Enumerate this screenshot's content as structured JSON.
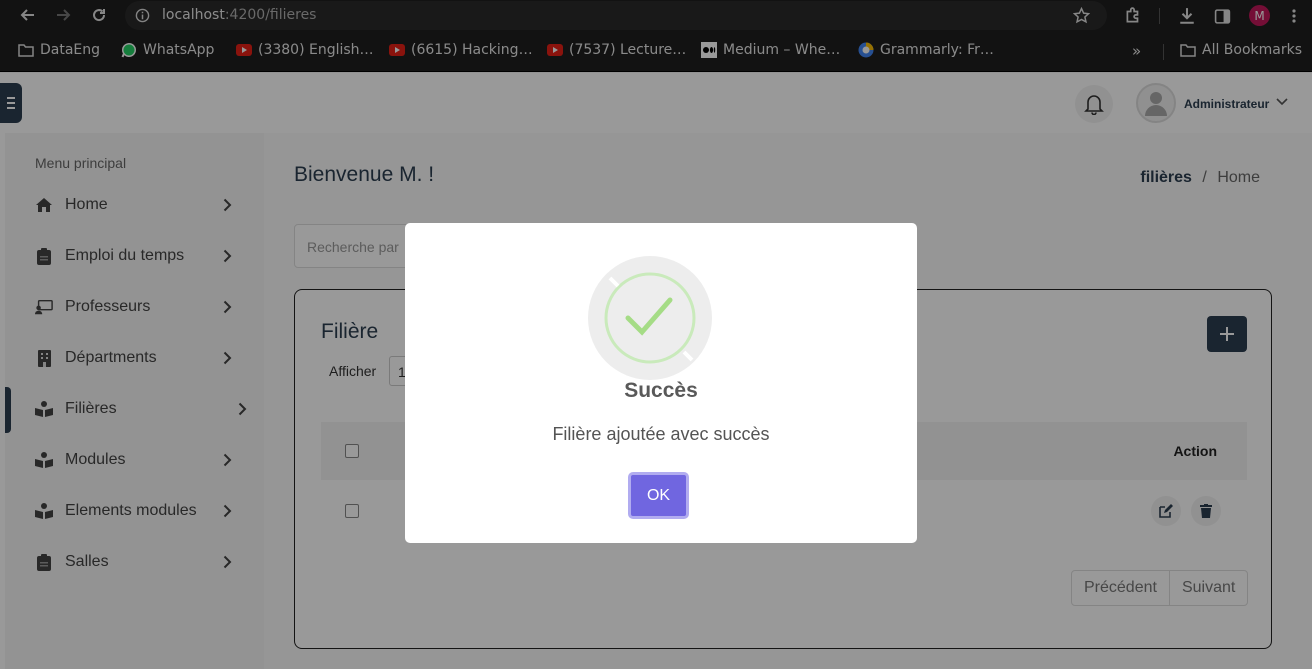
{
  "browser": {
    "url_host": "localhost",
    "url_path": ":4200/filieres",
    "profile_initial": "M",
    "bookmarks": [
      {
        "label": "DataEng",
        "icon": "folder-icon"
      },
      {
        "label": "WhatsApp",
        "icon": "whatsapp-icon"
      },
      {
        "label": "(3380) English…",
        "icon": "youtube-icon"
      },
      {
        "label": "(6615) Hacking…",
        "icon": "youtube-icon"
      },
      {
        "label": "(7537) Lecture…",
        "icon": "youtube-icon"
      },
      {
        "label": "Medium – Whe…",
        "icon": "medium-icon"
      },
      {
        "label": "Grammarly: Fr…",
        "icon": "grammarly-icon"
      }
    ],
    "overflow": "»",
    "all_bookmarks": "All Bookmarks"
  },
  "header": {
    "user_name": "Administrateur"
  },
  "sidebar": {
    "title": "Menu principal",
    "items": [
      {
        "label": "Home",
        "icon": "home-icon"
      },
      {
        "label": "Emploi du temps",
        "icon": "clipboard-icon"
      },
      {
        "label": "Professeurs",
        "icon": "teacher-icon"
      },
      {
        "label": "Départments",
        "icon": "building-icon"
      },
      {
        "label": "Filières",
        "icon": "book-reader-icon",
        "active": true
      },
      {
        "label": "Modules",
        "icon": "book-reader-icon"
      },
      {
        "label": "Elements modules",
        "icon": "book-reader-icon"
      },
      {
        "label": "Salles",
        "icon": "clipboard-icon"
      }
    ]
  },
  "main": {
    "welcome": "Bienvenue M. !",
    "breadcrumb_current": "filières",
    "breadcrumb_sep": "/",
    "breadcrumb_home": "Home",
    "search_placeholder": "Recherche par",
    "card_title": "Filière",
    "show_label": "Afficher",
    "show_value": "1",
    "action_header": "Action",
    "prev": "Précédent",
    "next": "Suivant"
  },
  "modal": {
    "title": "Succès",
    "message": "Filière ajoutée avec succès",
    "ok": "OK",
    "colors": {
      "confirm": "#7066e0",
      "check": "#a5dc86"
    }
  }
}
